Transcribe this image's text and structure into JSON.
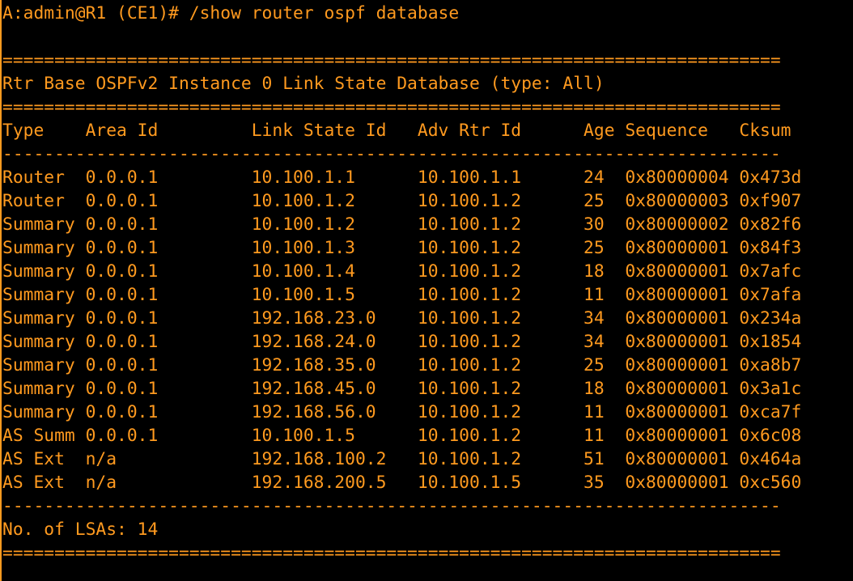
{
  "terminal": {
    "prompt_line": "A:admin@R1 (CE1)# /show router ospf database",
    "separator_double": "===========================================================================",
    "separator_single": "---------------------------------------------------------------------------",
    "title": "Rtr Base OSPFv2 Instance 0 Link State Database (type: All)",
    "columns": [
      "Type",
      "Area Id",
      "Link State Id",
      "Adv Rtr Id",
      "Age",
      "Sequence",
      "Cksum"
    ],
    "rows": [
      [
        "Router",
        "0.0.0.1",
        "10.100.1.1",
        "10.100.1.1",
        "24",
        "0x80000004",
        "0x473d"
      ],
      [
        "Router",
        "0.0.0.1",
        "10.100.1.2",
        "10.100.1.2",
        "25",
        "0x80000003",
        "0xf907"
      ],
      [
        "Summary",
        "0.0.0.1",
        "10.100.1.2",
        "10.100.1.2",
        "30",
        "0x80000002",
        "0x82f6"
      ],
      [
        "Summary",
        "0.0.0.1",
        "10.100.1.3",
        "10.100.1.2",
        "25",
        "0x80000001",
        "0x84f3"
      ],
      [
        "Summary",
        "0.0.0.1",
        "10.100.1.4",
        "10.100.1.2",
        "18",
        "0x80000001",
        "0x7afc"
      ],
      [
        "Summary",
        "0.0.0.1",
        "10.100.1.5",
        "10.100.1.2",
        "11",
        "0x80000001",
        "0x7afa"
      ],
      [
        "Summary",
        "0.0.0.1",
        "192.168.23.0",
        "10.100.1.2",
        "34",
        "0x80000001",
        "0x234a"
      ],
      [
        "Summary",
        "0.0.0.1",
        "192.168.24.0",
        "10.100.1.2",
        "34",
        "0x80000001",
        "0x1854"
      ],
      [
        "Summary",
        "0.0.0.1",
        "192.168.35.0",
        "10.100.1.2",
        "25",
        "0x80000001",
        "0xa8b7"
      ],
      [
        "Summary",
        "0.0.0.1",
        "192.168.45.0",
        "10.100.1.2",
        "18",
        "0x80000001",
        "0x3a1c"
      ],
      [
        "Summary",
        "0.0.0.1",
        "192.168.56.0",
        "10.100.1.2",
        "11",
        "0x80000001",
        "0xca7f"
      ],
      [
        "AS Summ",
        "0.0.0.1",
        "10.100.1.5",
        "10.100.1.2",
        "11",
        "0x80000001",
        "0x6c08"
      ],
      [
        "AS Ext",
        "n/a",
        "192.168.100.2",
        "10.100.1.2",
        "51",
        "0x80000001",
        "0x464a"
      ],
      [
        "AS Ext",
        "n/a",
        "192.168.200.5",
        "10.100.1.5",
        "35",
        "0x80000001",
        "0xc560"
      ]
    ],
    "footer": "No. of LSAs: 14",
    "colors": {
      "background": "#000000",
      "foreground": "#ff9a1f"
    }
  }
}
